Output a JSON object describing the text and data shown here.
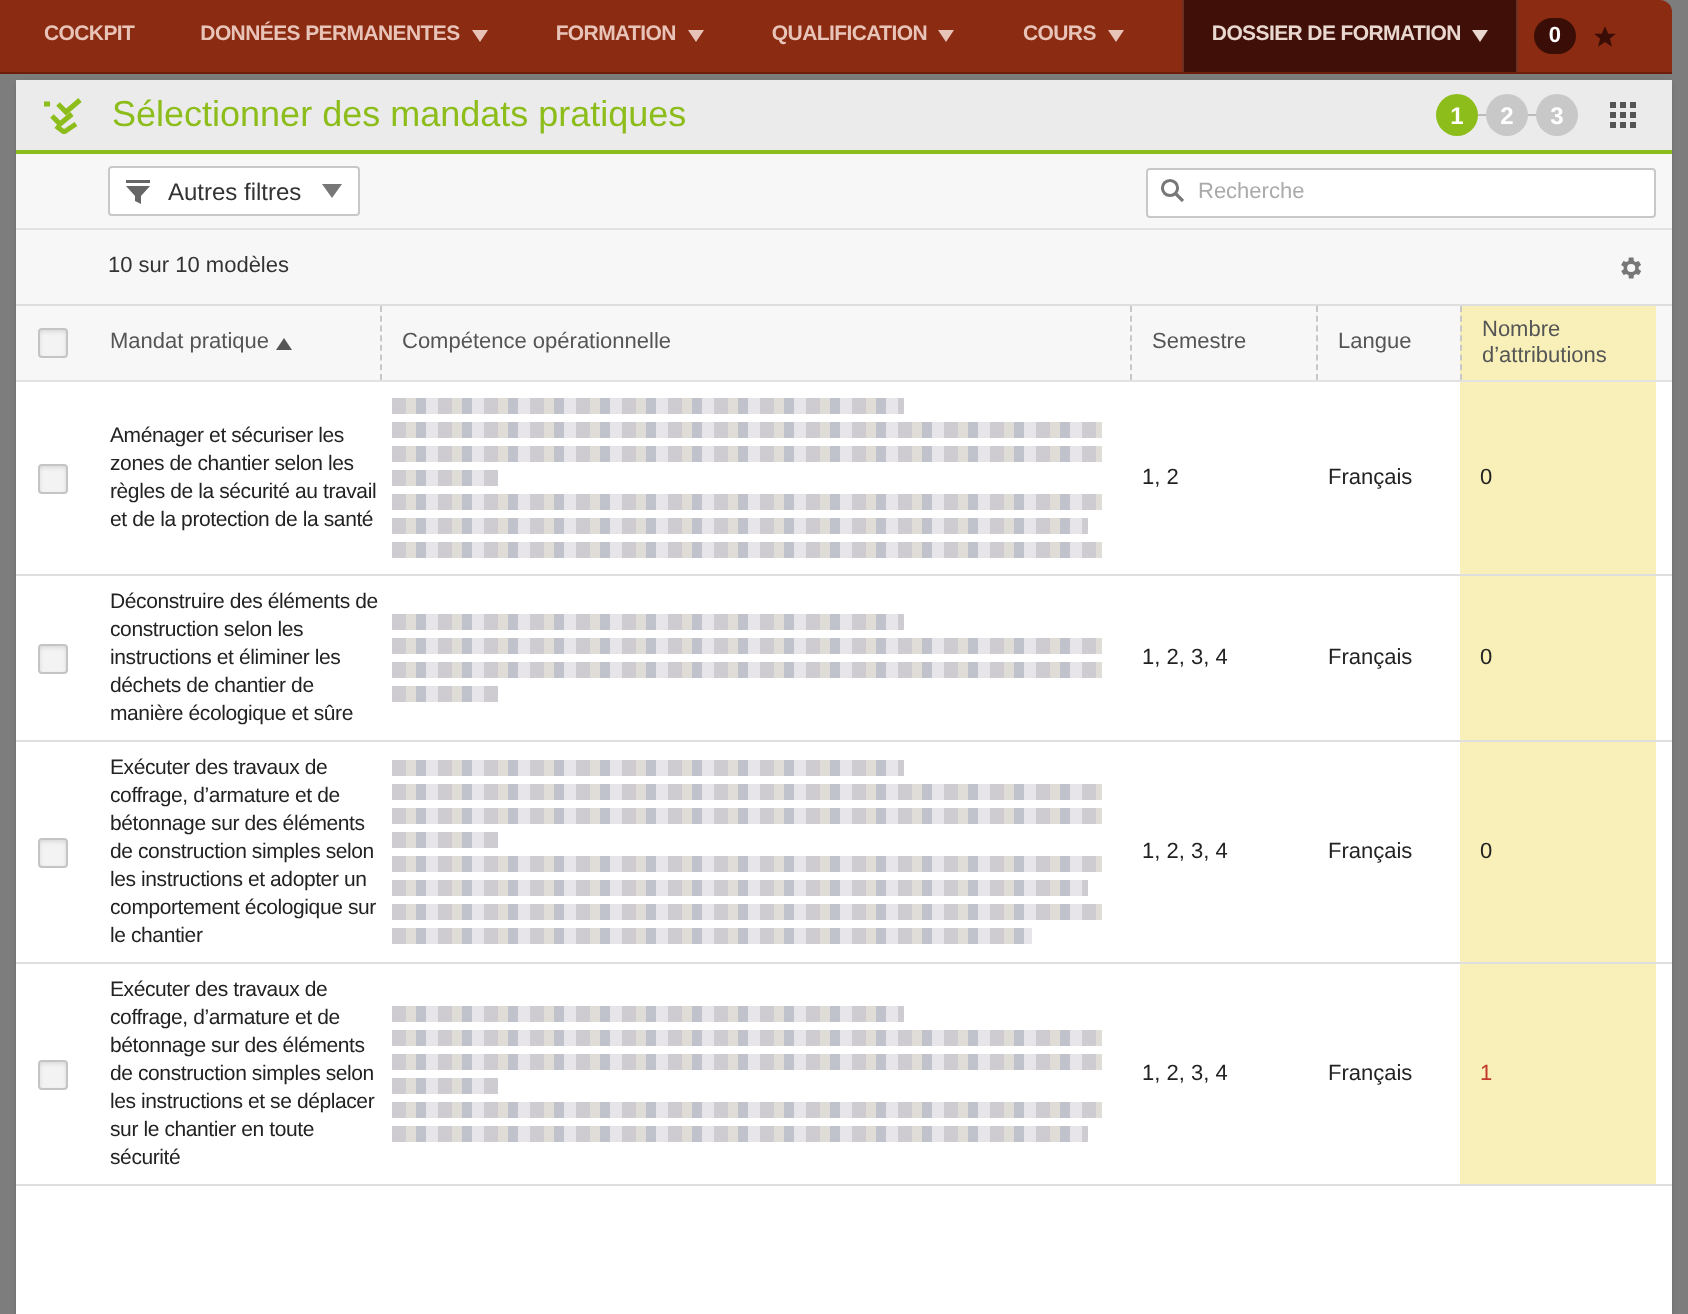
{
  "nav": {
    "items": [
      {
        "label": "COCKPIT",
        "dropdown": false,
        "selected": false
      },
      {
        "label": "DONNÉES PERMANENTES",
        "dropdown": true,
        "selected": false
      },
      {
        "label": "FORMATION",
        "dropdown": true,
        "selected": false
      },
      {
        "label": "QUALIFICATION",
        "dropdown": true,
        "selected": false
      },
      {
        "label": "COURS",
        "dropdown": true,
        "selected": false
      },
      {
        "label": "DOSSIER DE FORMATION",
        "dropdown": true,
        "selected": true
      }
    ],
    "badge": "0"
  },
  "panel": {
    "title": "Sélectionner des mandats pratiques",
    "steps": [
      {
        "label": "1",
        "selected": true
      },
      {
        "label": "2",
        "selected": false
      },
      {
        "label": "3",
        "selected": false
      }
    ]
  },
  "toolbar": {
    "filter_button": "Autres filtres",
    "search": {
      "placeholder": "Recherche"
    },
    "count": "10 sur 10 modèles"
  },
  "table": {
    "select_all": {
      "checked": false
    },
    "columns": [
      {
        "label": "Mandat pratique",
        "sorted": true
      },
      {
        "label": "Compétence opérationnelle",
        "sorted": false
      },
      {
        "label": "Semestre",
        "sorted": false
      },
      {
        "label": "Langue",
        "sorted": false
      },
      {
        "label": "Nombre d’attributions",
        "sorted": false
      }
    ],
    "rows": [
      {
        "checked": false,
        "mandat": "Aménager et sécuriser les zones de chantier selon les règles de la sécurité au travail et de la protection de la santé",
        "semestre": "1, 2",
        "langue": "Français",
        "count": "0",
        "highlighted": false
      },
      {
        "checked": false,
        "mandat": "Déconstruire des éléments de construction selon les instructions et éliminer les déchets de chantier de manière écologique et sûre",
        "semestre": "1, 2, 3, 4",
        "langue": "Français",
        "count": "0",
        "highlighted": false
      },
      {
        "checked": false,
        "mandat": "Exécuter des travaux de coffrage, d’armature et de bétonnage sur des éléments de construction simples selon les instructions et adopter un comportement écologique sur le chantier",
        "semestre": "1, 2, 3, 4",
        "langue": "Français",
        "count": "0",
        "highlighted": false
      },
      {
        "checked": false,
        "mandat": "Exécuter des travaux de coffrage, d’armature et de bétonnage sur des éléments de construction simples selon les instructions et se déplacer sur le chantier en toute sécurité",
        "semestre": "1, 2, 3, 4",
        "langue": "Français",
        "count": "1",
        "highlighted": true
      }
    ]
  }
}
